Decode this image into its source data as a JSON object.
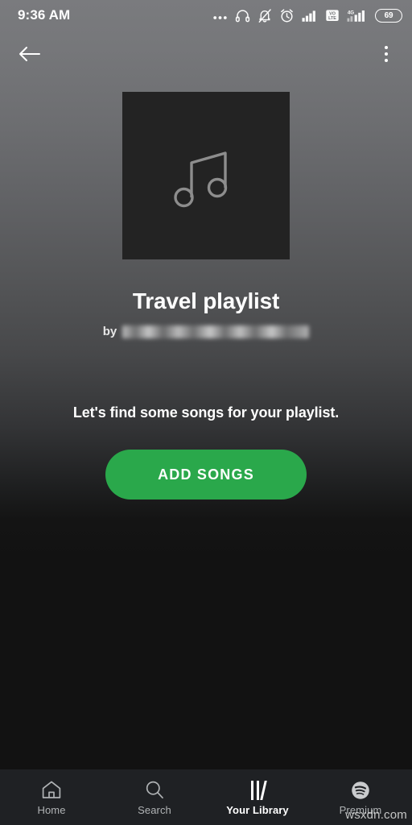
{
  "status_bar": {
    "time": "9:36 AM",
    "battery_level": "69",
    "icons": [
      "more-ellipsis-icon",
      "headphones-icon",
      "bell-muted-icon",
      "alarm-clock-icon",
      "signal-bars-icon",
      "volte-icon",
      "signal-4g-icon",
      "battery-icon"
    ],
    "network_label": "4G",
    "volte_top": "VO",
    "volte_bottom": "LTE"
  },
  "app_bar": {
    "back_label": "Back",
    "overflow_label": "More options"
  },
  "playlist": {
    "cover_icon": "music-note-icon",
    "title": "Travel playlist",
    "by_label": "by",
    "owner": ""
  },
  "empty_state": {
    "message": "Let's find some songs for your playlist.",
    "button_label": "ADD SONGS"
  },
  "bottom_nav": {
    "items": [
      {
        "label": "Home",
        "icon": "home-icon",
        "active": false
      },
      {
        "label": "Search",
        "icon": "search-icon",
        "active": false
      },
      {
        "label": "Your Library",
        "icon": "library-icon",
        "active": true
      },
      {
        "label": "Premium",
        "icon": "spotify-logo-icon",
        "active": false
      }
    ]
  },
  "watermark": {
    "text": "wsxdn.com"
  },
  "colors": {
    "accent_green": "#2aa84b",
    "background_dark": "#121212",
    "nav_background": "#1f2124",
    "cover_background": "#232323"
  }
}
